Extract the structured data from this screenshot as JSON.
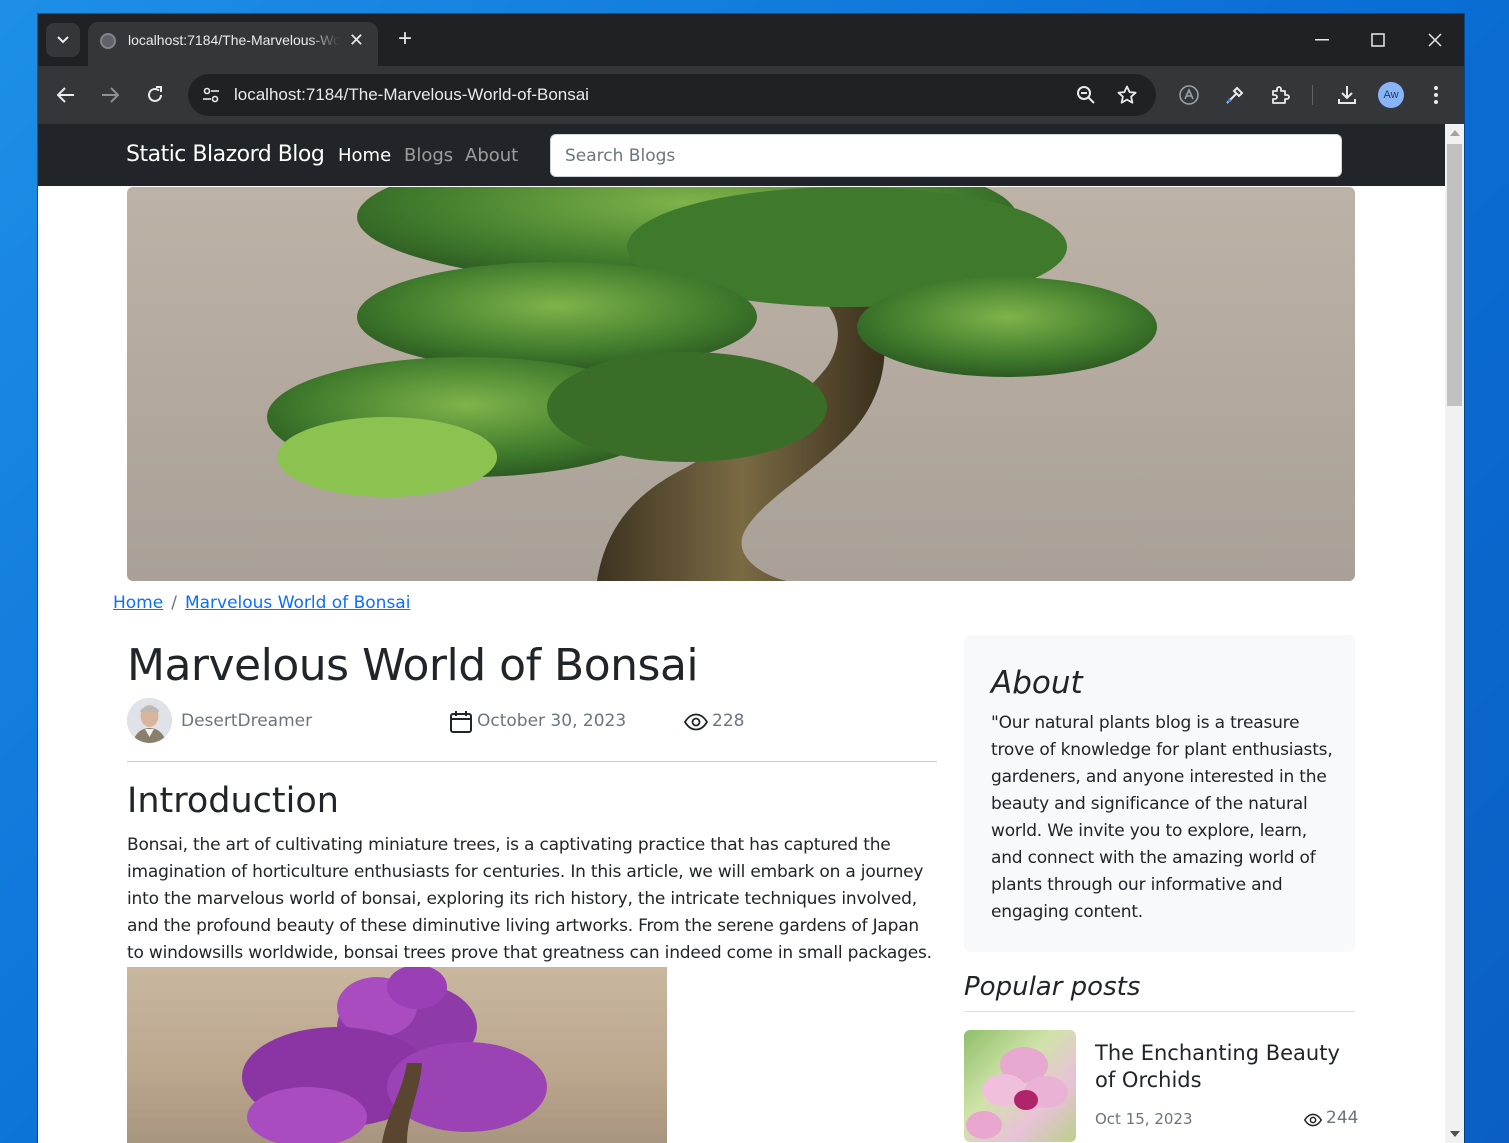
{
  "browser": {
    "tab_title": "localhost:7184/The-Marvelous-World-of-Bonsai",
    "tab_close": "✕",
    "new_tab": "+",
    "url": "localhost:7184/The-Marvelous-World-of-Bonsai",
    "profile_initials": "Aw"
  },
  "site": {
    "brand": "Static Blazord Blog",
    "nav": [
      {
        "label": "Home",
        "active": true
      },
      {
        "label": "Blogs",
        "active": false
      },
      {
        "label": "About",
        "active": false
      }
    ],
    "search_placeholder": "Search Blogs"
  },
  "breadcrumb": {
    "home": "Home",
    "separator": "/",
    "current": "Marvelous World of Bonsai"
  },
  "article": {
    "title": "Marvelous World of Bonsai",
    "author": "DesertDreamer",
    "date": "October 30, 2023",
    "views": "228",
    "section_heading": "Introduction",
    "intro": "Bonsai, the art of cultivating miniature trees, is a captivating practice that has captured the imagination of horticulture enthusiasts for centuries. In this article, we will embark on a journey into the marvelous world of bonsai, exploring its rich history, the intricate techniques involved, and the profound beauty of these diminutive living artworks. From the serene gardens of Japan to windowsills worldwide, bonsai trees prove that greatness can indeed come in small packages."
  },
  "sidebar": {
    "about_title": "About",
    "about_text": "\"Our natural plants blog is a treasure trove of knowledge for plant enthusiasts, gardeners, and anyone interested in the beauty and significance of the natural world. We invite you to explore, learn, and connect with the amazing world of plants through our informative and engaging content.",
    "popular_title": "Popular posts",
    "posts": [
      {
        "title": "The Enchanting Beauty of Orchids",
        "date": "Oct 15, 2023",
        "views": "244"
      }
    ]
  },
  "icons": {
    "tab_menu": "chevron-down-icon",
    "back": "arrow-left-icon",
    "forward": "arrow-right-icon",
    "reload": "reload-icon",
    "site_info": "tune-icon",
    "zoom": "zoom-icon",
    "bookmark": "star-icon",
    "translate": "translate-icon",
    "eyedropper": "eyedropper-icon",
    "extensions": "puzzle-icon",
    "download": "download-icon",
    "menu": "kebab-menu-icon"
  },
  "colors": {
    "navbar_bg": "#212529",
    "link": "#0d6efd",
    "muted": "#6c757d",
    "card_bg": "#f8f9fa",
    "chrome_dark": "#202124",
    "chrome_toolbar": "#35363a"
  }
}
